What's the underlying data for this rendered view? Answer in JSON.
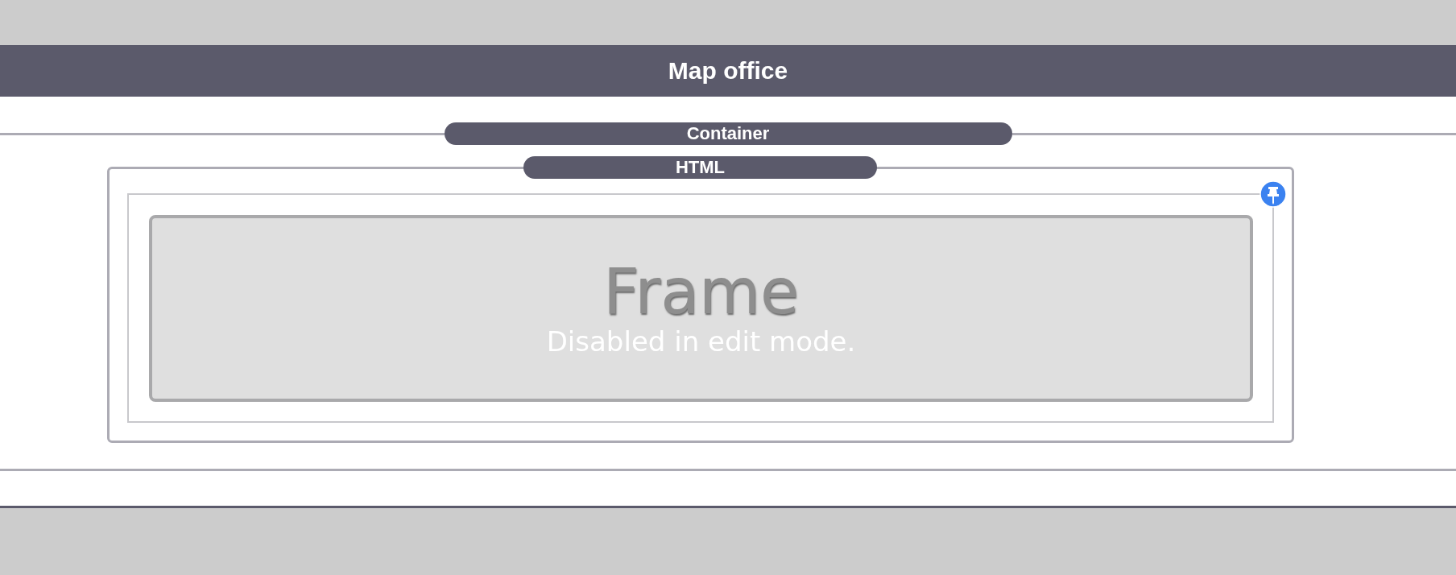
{
  "header": {
    "title": "Map office"
  },
  "container": {
    "label": "Container",
    "html": {
      "label": "HTML",
      "pinned": true,
      "frame": {
        "title": "Frame",
        "message": "Disabled in edit mode."
      }
    }
  }
}
